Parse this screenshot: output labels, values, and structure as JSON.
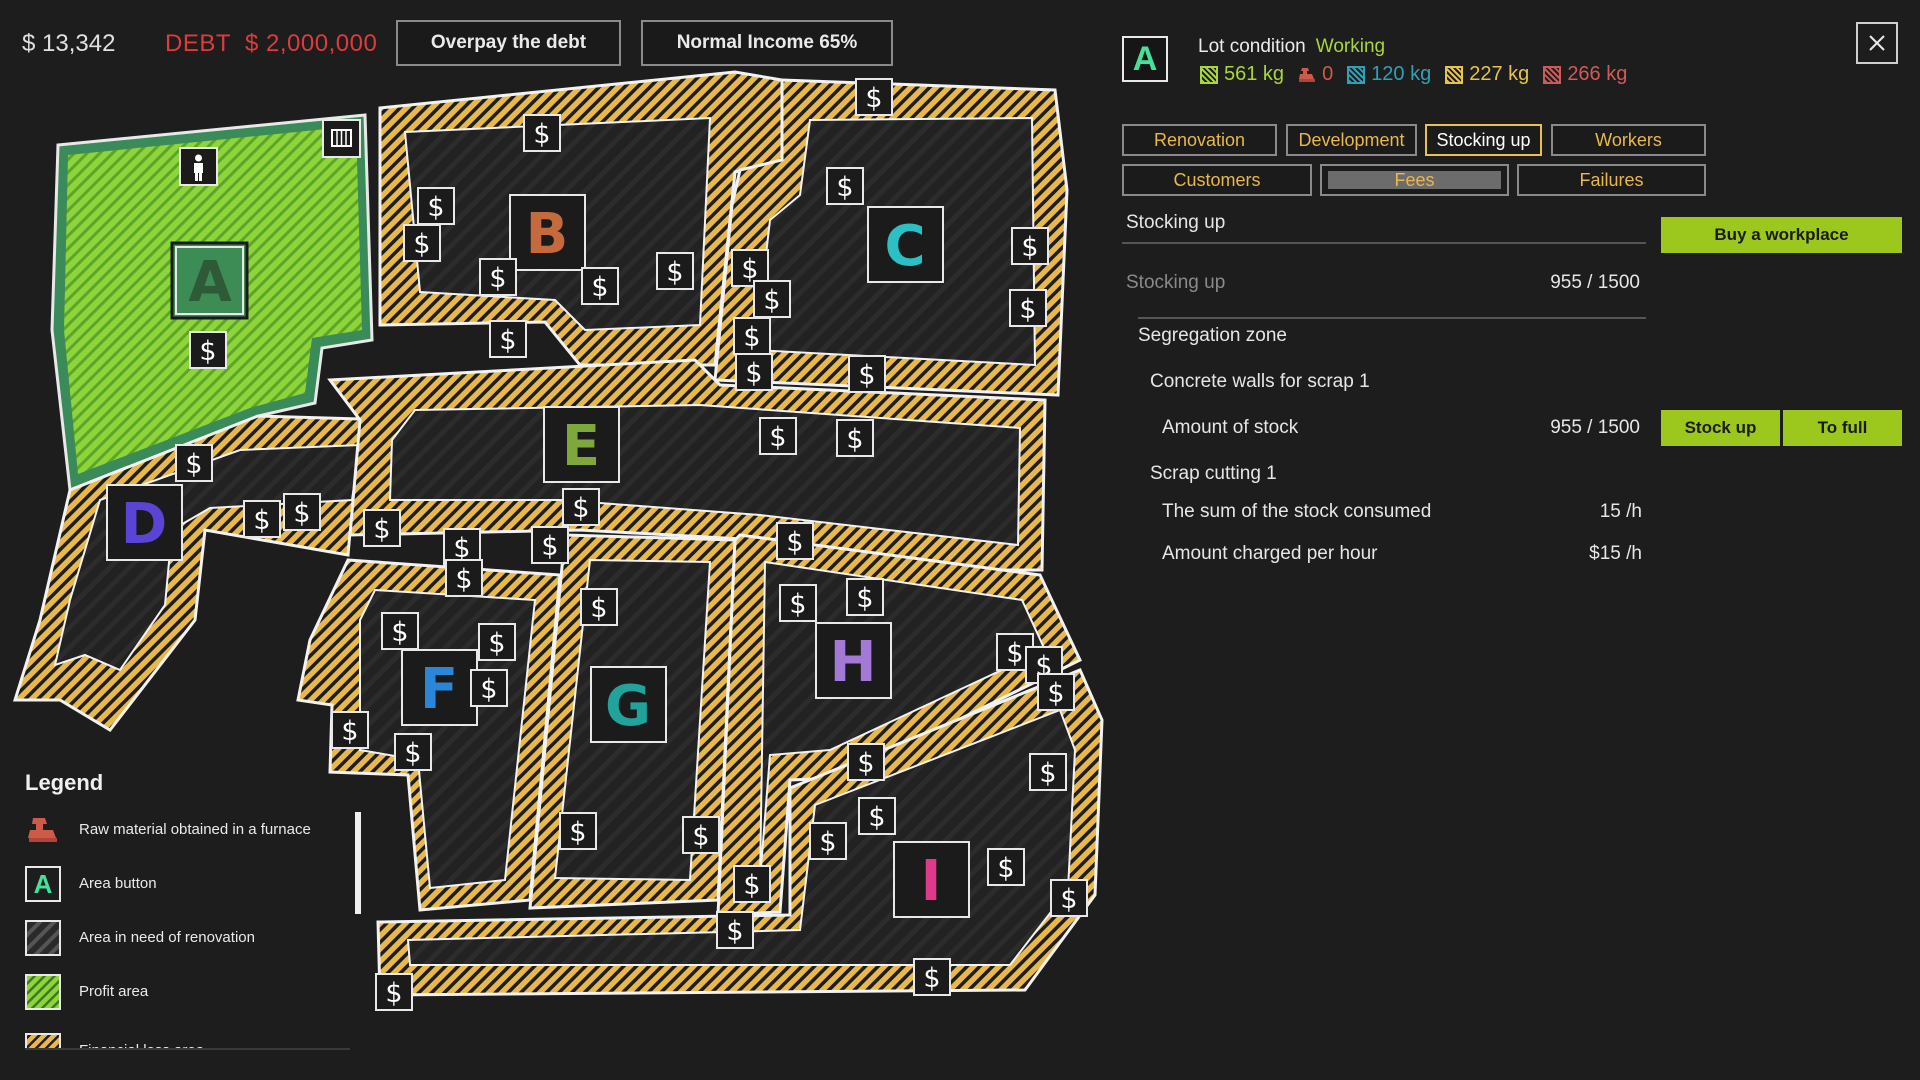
{
  "top": {
    "money": "$ 13,342",
    "debt_label": "DEBT",
    "debt_amount": "$ 2,000,000",
    "overpay_btn": "Overpay the debt",
    "income_btn": "Normal Income 65%"
  },
  "map": {
    "zones": [
      {
        "letter": "A",
        "color": "#2f5a37"
      },
      {
        "letter": "B",
        "color": "#c46a3c"
      },
      {
        "letter": "C",
        "color": "#2cc0c4"
      },
      {
        "letter": "D",
        "color": "#5a44d6"
      },
      {
        "letter": "E",
        "color": "#7fa83c"
      },
      {
        "letter": "F",
        "color": "#2b86d8"
      },
      {
        "letter": "G",
        "color": "#1fa39a"
      },
      {
        "letter": "H",
        "color": "#a27ad6"
      },
      {
        "letter": "I",
        "color": "#e0388a"
      }
    ],
    "dollar": "$"
  },
  "legend": {
    "title": "Legend",
    "items": [
      {
        "label": "Raw material obtained in a furnace"
      },
      {
        "label": "Area button",
        "glyph": "A"
      },
      {
        "label": "Area in need of renovation"
      },
      {
        "label": "Profit area"
      },
      {
        "label": "Financial loss area"
      }
    ]
  },
  "panel": {
    "lot_letter": "A",
    "lot_condition_label": "Lot condition",
    "lot_condition_value": "Working",
    "resources": [
      {
        "value": "561 kg",
        "color": "#a8d63a"
      },
      {
        "value": "0",
        "color": "#d05a4a"
      },
      {
        "value": "120 kg",
        "color": "#2fa0b8"
      },
      {
        "value": "227 kg",
        "color": "#e8c24a"
      },
      {
        "value": "266 kg",
        "color": "#d05a5a"
      }
    ],
    "tabs": {
      "renovation": "Renovation",
      "development": "Development",
      "stocking": "Stocking up",
      "workers": "Workers",
      "customers": "Customers",
      "fees": "Fees",
      "failures": "Failures"
    },
    "section_title": "Stocking up",
    "buy_btn": "Buy a workplace",
    "stock_row_label": "Stocking up",
    "stock_row_value": "955 / 1500",
    "segregation": "Segregation zone",
    "concrete": "Concrete walls for scrap 1",
    "amount_label": "Amount of stock",
    "amount_value": "955 / 1500",
    "stock_up_btn": "Stock up",
    "to_full_btn": "To full",
    "scrap": "Scrap cutting 1",
    "consumed_label": "The sum of the stock consumed",
    "consumed_value": "15 /h",
    "charged_label": "Amount charged per hour",
    "charged_value": "$15 /h"
  },
  "colors": {
    "accent_green": "#9cc81e",
    "debt_red": "#e03a3a",
    "hatch_yellow": "#e8b84a",
    "profit_green": "#7cc73a"
  }
}
